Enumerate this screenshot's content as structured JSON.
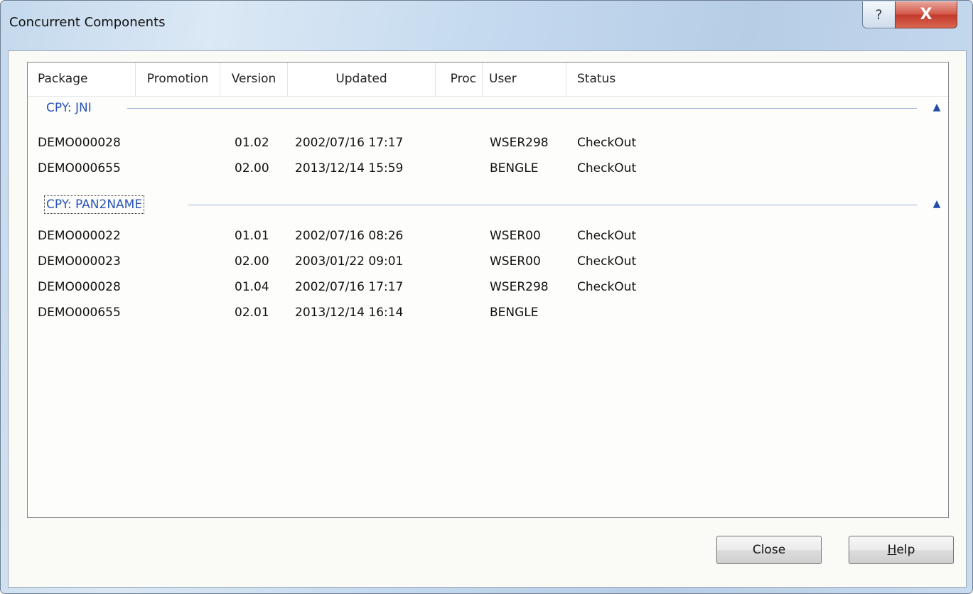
{
  "window": {
    "title": "Concurrent Components",
    "help_glyph": "?",
    "close_glyph": "X"
  },
  "columns": [
    {
      "label": "Package"
    },
    {
      "label": "Promotion"
    },
    {
      "label": "Version"
    },
    {
      "label": "Updated"
    },
    {
      "label": "Proc"
    },
    {
      "label": "User"
    },
    {
      "label": "Status"
    }
  ],
  "groups": [
    {
      "label": "CPY:  JNI",
      "collapse_icon": "chevron-up-icon",
      "rows": [
        {
          "package": "DEMO000028",
          "promotion": "",
          "version": "01.02",
          "updated": "2002/07/16  17:17",
          "proc": "",
          "user": "WSER298",
          "status": "CheckOut"
        },
        {
          "package": "DEMO000655",
          "promotion": "",
          "version": "02.00",
          "updated": "2013/12/14  15:59",
          "proc": "",
          "user": "BENGLE",
          "status": "CheckOut"
        }
      ]
    },
    {
      "label": "CPY:  PAN2NAME",
      "collapse_icon": "chevron-up-icon",
      "rows": [
        {
          "package": "DEMO000022",
          "promotion": "",
          "version": "01.01",
          "updated": "2002/07/16  08:26",
          "proc": "",
          "user": "WSER00",
          "status": "CheckOut"
        },
        {
          "package": "DEMO000023",
          "promotion": "",
          "version": "02.00",
          "updated": "2003/01/22  09:01",
          "proc": "",
          "user": "WSER00",
          "status": "CheckOut"
        },
        {
          "package": "DEMO000028",
          "promotion": "",
          "version": "01.04",
          "updated": "2002/07/16  17:17",
          "proc": "",
          "user": "WSER298",
          "status": "CheckOut"
        },
        {
          "package": "DEMO000655",
          "promotion": "",
          "version": "02.01",
          "updated": "2013/12/14  16:14",
          "proc": "",
          "user": "BENGLE",
          "status": ""
        }
      ]
    }
  ],
  "buttons": {
    "close_label": "Close",
    "help_label_mnemonic": "H",
    "help_label_rest": "elp"
  }
}
